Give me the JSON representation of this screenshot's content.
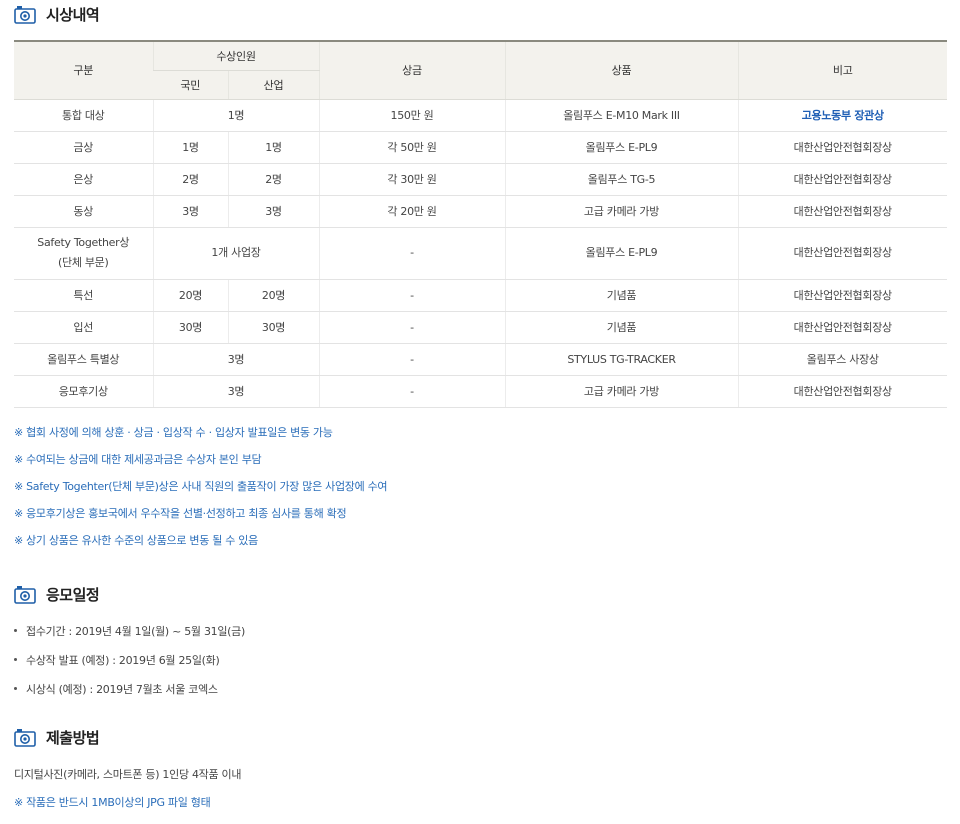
{
  "sections": {
    "awards_title": "시상내역",
    "schedule_title": "응모일정",
    "submission_title": "제출방법"
  },
  "table": {
    "headers": {
      "category": "구분",
      "winners": "수상인원",
      "citizen": "국민",
      "industry": "산업",
      "prize_money": "상금",
      "prize_goods": "상품",
      "note": "비고"
    },
    "rows": [
      {
        "category": "통합 대상",
        "merged": "1명",
        "money": "150만 원",
        "goods": "올림푸스 E-M10 Mark III",
        "note": "고용노동부 장관상"
      },
      {
        "category": "금상",
        "citizen": "1명",
        "industry": "1명",
        "money": "각 50만 원",
        "goods": "올림푸스 E-PL9",
        "note": "대한산업안전협회장상"
      },
      {
        "category": "은상",
        "citizen": "2명",
        "industry": "2명",
        "money": "각 30만 원",
        "goods": "올림푸스 TG-5",
        "note": "대한산업안전협회장상"
      },
      {
        "category": "동상",
        "citizen": "3명",
        "industry": "3명",
        "money": "각 20만 원",
        "goods": "고급 카메라 가방",
        "note": "대한산업안전협회장상"
      },
      {
        "category_line1": "Safety Together상",
        "category_line2": "(단체 부문)",
        "merged": "1개 사업장",
        "money": "-",
        "goods": "올림푸스 E-PL9",
        "note": "대한산업안전협회장상"
      },
      {
        "category": "특선",
        "citizen": "20명",
        "industry": "20명",
        "money": "-",
        "goods": "기념품",
        "note": "대한산업안전협회장상"
      },
      {
        "category": "입선",
        "citizen": "30명",
        "industry": "30명",
        "money": "-",
        "goods": "기념품",
        "note": "대한산업안전협회장상"
      },
      {
        "category": "올림푸스 특별상",
        "merged": "3명",
        "money": "-",
        "goods": "STYLUS TG-TRACKER",
        "note": "올림푸스 사장상"
      },
      {
        "category": "응모후기상",
        "merged": "3명",
        "money": "-",
        "goods": "고급 카메라 가방",
        "note": "대한산업안전협회장상"
      }
    ]
  },
  "notes": [
    "※ 협회 사정에 의해 상훈 · 상금 · 입상작 수 · 입상자 발표일은 변동 가능",
    "※ 수여되는 상금에 대한 제세공과금은 수상자 본인 부담",
    "※ Safety Togehter(단체 부문)상은 사내 직원의 출품작이 가장 많은 사업장에 수여",
    "※ 응모후기상은 홍보국에서 우수작을 선별·선정하고 최종 심사를 통해 확정",
    "※ 상기 상품은 유사한 수준의 상품으로 변동 될 수 있음"
  ],
  "schedule": [
    "접수기간 : 2019년 4월 1일(월) ~ 5월 31일(금)",
    "수상작 발표 (예정) : 2019년 6월 25일(화)",
    "시상식 (예정) : 2019년 7월초 서울 코엑스"
  ],
  "submission": {
    "text": "디지털사진(카메라, 스마트폰 등) 1인당 4작품 이내",
    "note": "※ 작품은 반드시 1MB이상의 JPG 파일 형태"
  },
  "colors": {
    "accent_blue": "#2a6db9",
    "header_bg": "#f3f2ed",
    "icon_blue": "#1f5fa8"
  },
  "icons": {
    "section_icon": "camera-icon"
  }
}
